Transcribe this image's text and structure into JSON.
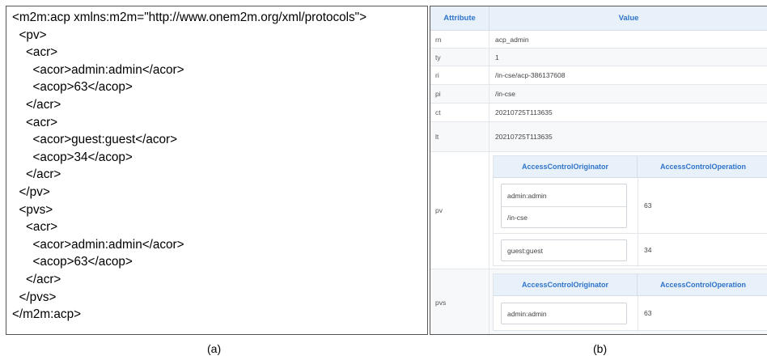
{
  "xml": {
    "lines": [
      "<m2m:acp xmlns:m2m=\"http://www.onem2m.org/xml/protocols\">",
      "  <pv>",
      "    <acr>",
      "      <acor>admin:admin</acor>",
      "      <acop>63</acop>",
      "    </acr>",
      "    <acr>",
      "      <acor>guest:guest</acor>",
      "      <acop>34</acop>",
      "    </acr>",
      "  </pv>",
      "  <pvs>",
      "    <acr>",
      "      <acor>admin:admin</acor>",
      "      <acop>63</acop>",
      "    </acr>",
      "  </pvs>",
      "</m2m:acp>"
    ]
  },
  "table": {
    "header_attribute": "Attribute",
    "header_value": "Value",
    "rows": [
      {
        "attr": "rn",
        "value": "acp_admin"
      },
      {
        "attr": "ty",
        "value": "1"
      },
      {
        "attr": "ri",
        "value": "/in-cse/acp-386137608"
      },
      {
        "attr": "pi",
        "value": "/in-cse"
      },
      {
        "attr": "ct",
        "value": "20210725T113635"
      },
      {
        "attr": "lt",
        "value": "20210725T113635"
      }
    ],
    "pv": {
      "attr": "pv",
      "col_originator": "AccessControlOriginator",
      "col_operation": "AccessControlOperation",
      "entries": [
        {
          "originators": [
            "admin:admin",
            "/in-cse"
          ],
          "operation": "63"
        },
        {
          "originators": [
            "guest:guest"
          ],
          "operation": "34"
        }
      ]
    },
    "pvs": {
      "attr": "pvs",
      "col_originator": "AccessControlOriginator",
      "col_operation": "AccessControlOperation",
      "entries": [
        {
          "originators": [
            "admin:admin"
          ],
          "operation": "63"
        }
      ]
    }
  },
  "captions": {
    "a": "(a)",
    "b": "(b)"
  }
}
